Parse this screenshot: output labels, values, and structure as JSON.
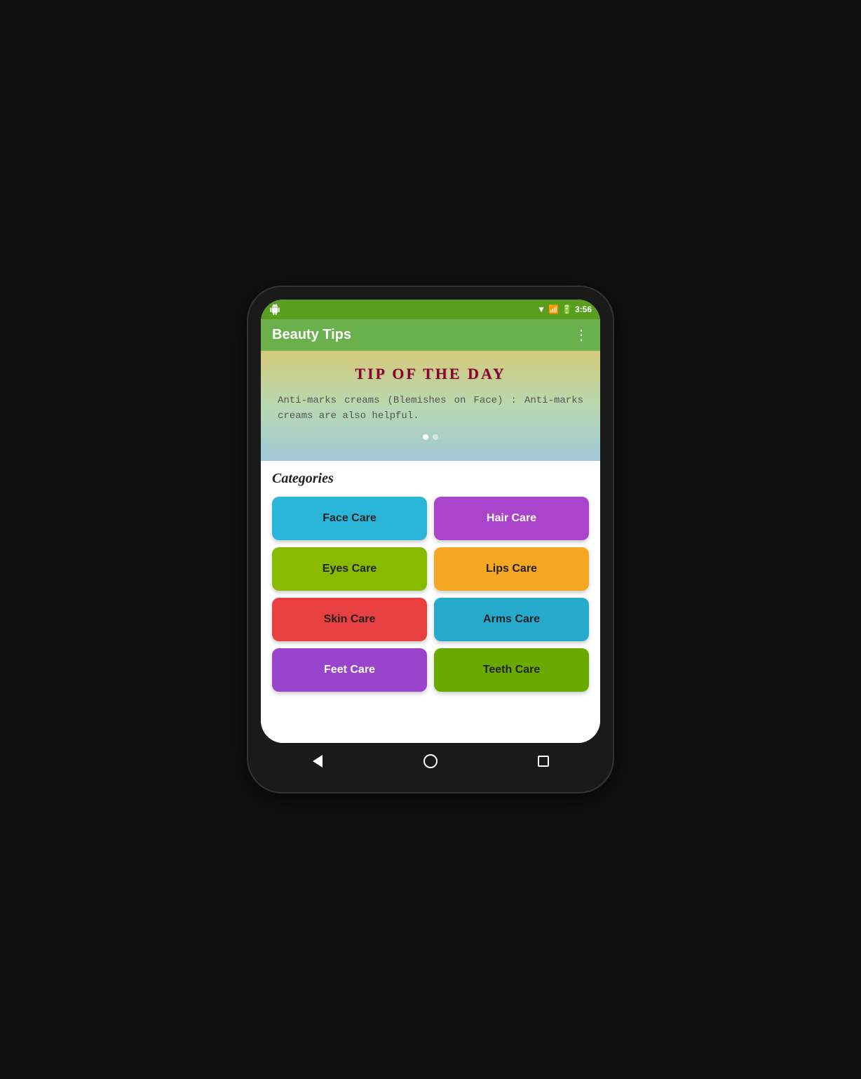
{
  "statusBar": {
    "time": "3:56"
  },
  "appBar": {
    "title": "Beauty Tips",
    "menuLabel": "⋮"
  },
  "banner": {
    "tipTitle": "TIP OF THE DAY",
    "tipText": "Anti-marks creams (Blemishes on Face) : Anti-marks creams are also helpful.",
    "dots": [
      true,
      false
    ]
  },
  "categories": {
    "sectionTitle": "Categories",
    "items": [
      {
        "id": "face-care",
        "label": "Face Care",
        "colorClass": "btn-face-care"
      },
      {
        "id": "hair-care",
        "label": "Hair Care",
        "colorClass": "btn-hair-care"
      },
      {
        "id": "eyes-care",
        "label": "Eyes Care",
        "colorClass": "btn-eyes-care"
      },
      {
        "id": "lips-care",
        "label": "Lips Care",
        "colorClass": "btn-lips-care"
      },
      {
        "id": "skin-care",
        "label": "Skin Care",
        "colorClass": "btn-skin-care"
      },
      {
        "id": "arms-care",
        "label": "Arms Care",
        "colorClass": "btn-arms-care"
      },
      {
        "id": "feet-care",
        "label": "Feet Care",
        "colorClass": "btn-feet-care"
      },
      {
        "id": "teeth-care",
        "label": "Teeth Care",
        "colorClass": "btn-teeth-care"
      }
    ]
  },
  "bottomNav": {
    "back": "back",
    "home": "home",
    "recents": "recents"
  }
}
